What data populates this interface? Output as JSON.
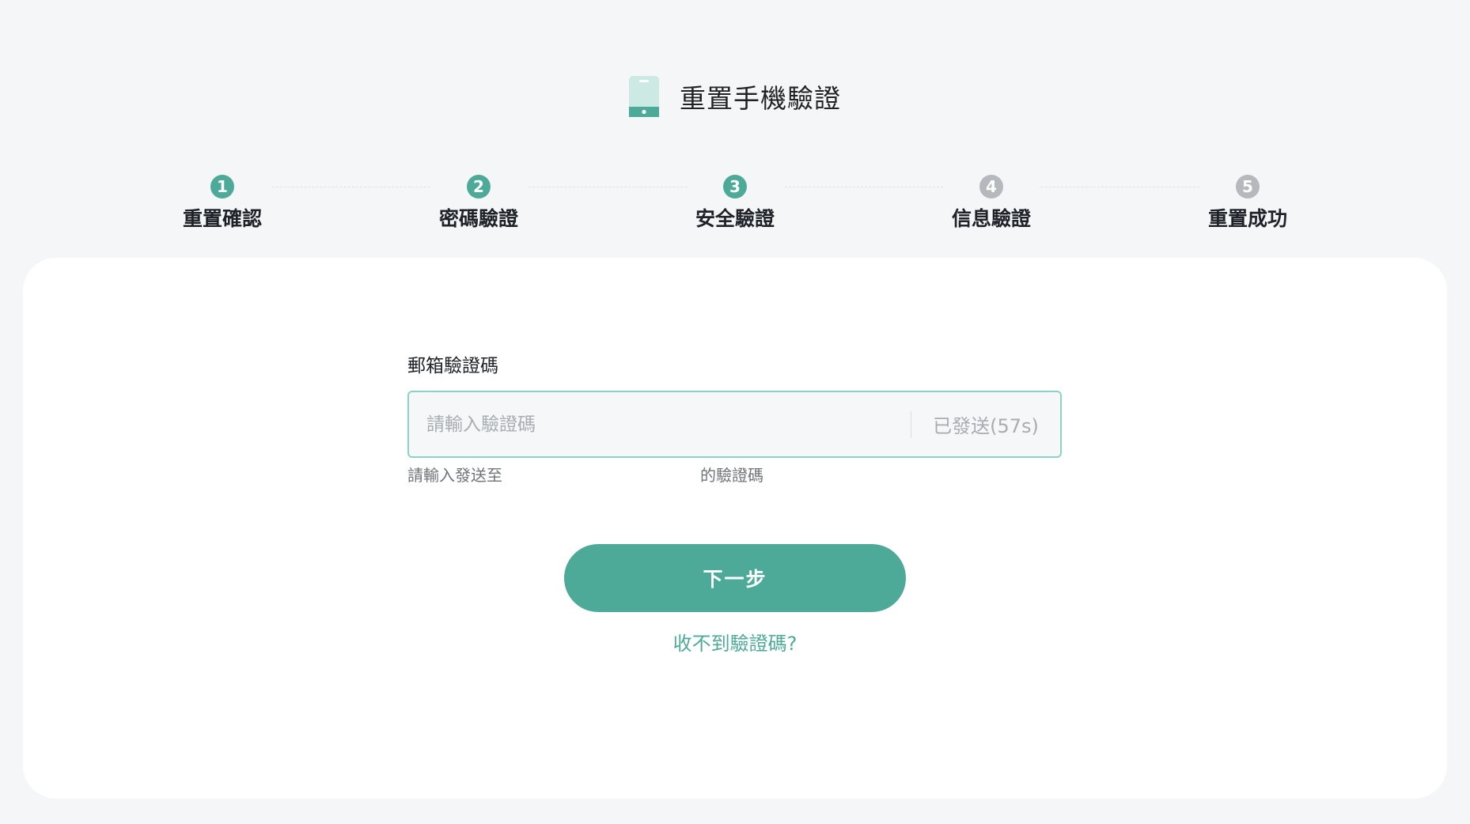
{
  "header": {
    "title": "重置手機驗證",
    "icon": "phone-icon"
  },
  "colors": {
    "accent": "#4eaa98",
    "inactive": "#b5b8bc",
    "background": "#f5f6f7",
    "card": "#ffffff"
  },
  "stepper": {
    "steps": [
      {
        "number": "1",
        "label": "重置確認",
        "state": "active"
      },
      {
        "number": "2",
        "label": "密碼驗證",
        "state": "active"
      },
      {
        "number": "3",
        "label": "安全驗證",
        "state": "active"
      },
      {
        "number": "4",
        "label": "信息驗證",
        "state": "inactive"
      },
      {
        "number": "5",
        "label": "重置成功",
        "state": "inactive"
      }
    ]
  },
  "form": {
    "field_label": "郵箱驗證碼",
    "input_value": "",
    "input_placeholder": "請輸入驗證碼",
    "resend_label": "已發送(57s)",
    "hint_prefix": "請輸入發送至",
    "hint_suffix": "的驗證碼"
  },
  "actions": {
    "next_label": "下一步",
    "help_link": "收不到驗證碼?"
  }
}
